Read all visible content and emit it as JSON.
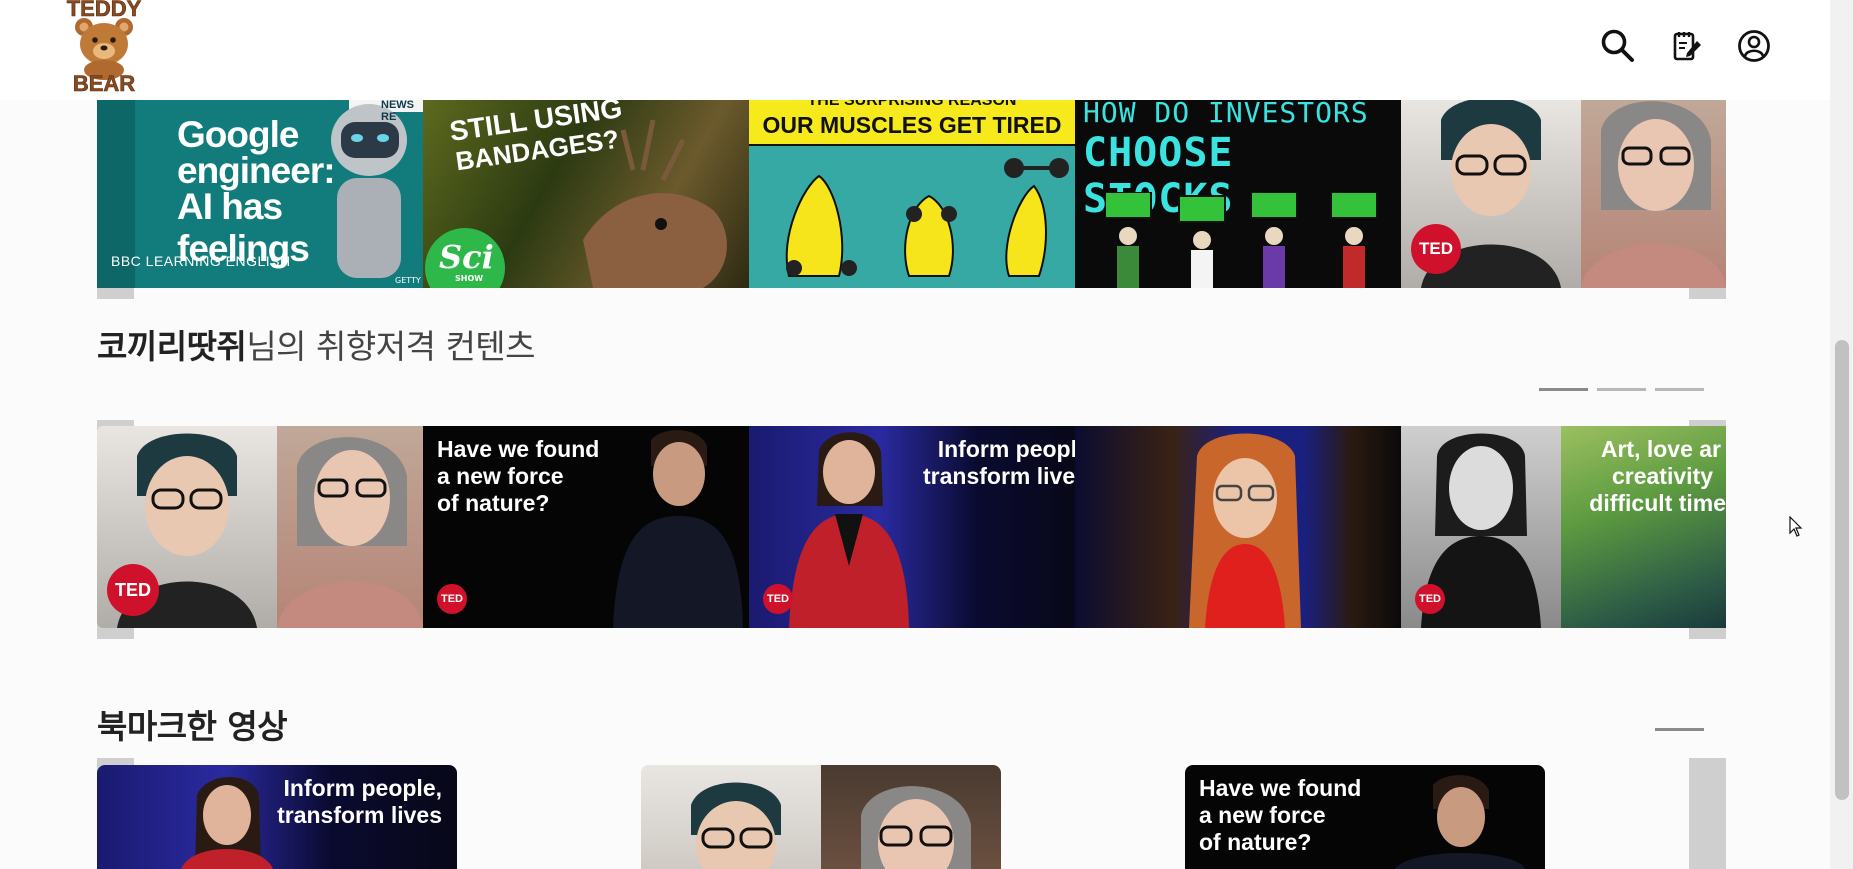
{
  "header": {
    "logo_line1": "TEDDY",
    "logo_line2": "BEAR",
    "icons": [
      "search-icon",
      "notes-icon",
      "user-icon"
    ]
  },
  "row1": {
    "thumbs": [
      {
        "text1": "Google",
        "text2": "engineer:",
        "text3": "AI has feelings",
        "corner": "NEWS RE",
        "brand": "BBC LEARNING ENGLISH",
        "credit": "GETTY"
      },
      {
        "text1": "STILL USING",
        "text2": "BANDAGES?",
        "brand": "Sci",
        "brand_sub": "SHOW"
      },
      {
        "text1": "THE SURPRISING REASON",
        "text2": "OUR MUSCLES GET TIRED"
      },
      {
        "text1": "HOW DO INVESTORS",
        "text2": "CHOOSE STOCKS"
      },
      {
        "badge": "TED"
      }
    ]
  },
  "section2": {
    "title_bold": "코끼리땃쥐",
    "title_rest": "님의 취향저격 컨텐츠",
    "thumbs": [
      {
        "badge": "TED"
      },
      {
        "text": [
          "Have we found",
          "a new force",
          "of nature?"
        ],
        "badge": "TED"
      },
      {
        "text": [
          "Inform peopl",
          "transform live"
        ],
        "badge": "TED"
      },
      {},
      {
        "badge": "TED"
      },
      {
        "text": [
          "Art, love ar",
          "creativity",
          "difficult time"
        ]
      }
    ]
  },
  "section3": {
    "title": "북마크한 영상",
    "cards": [
      {
        "text": [
          "Inform people,",
          "transform lives"
        ]
      },
      {},
      {
        "text": [
          "Have we found",
          "a new force",
          "of nature?"
        ]
      }
    ]
  },
  "colors": {
    "ted_red": "#d0112b",
    "teal": "#127c7c",
    "muscle_teal": "#37a9a4",
    "yellow": "#f7ea1c",
    "stock_text": "#3ae3e0"
  }
}
